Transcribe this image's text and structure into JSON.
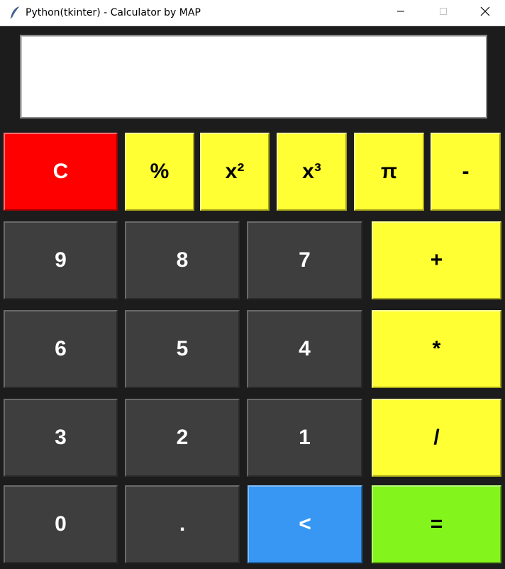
{
  "window": {
    "title": "Python(tkinter) - Calculator by MAP"
  },
  "display": {
    "value": ""
  },
  "buttons": {
    "clear": "C",
    "percent": "%",
    "square": "x²",
    "cube": "x³",
    "pi": "π",
    "minus": "-",
    "nine": "9",
    "eight": "8",
    "seven": "7",
    "plus": "+",
    "six": "6",
    "five": "5",
    "four": "4",
    "multiply": "*",
    "three": "3",
    "two": "2",
    "one": "1",
    "divide": "/",
    "zero": "0",
    "dot": ".",
    "backspace": "<",
    "equals": "="
  },
  "colors": {
    "background": "#1c1c1c",
    "dark_key": "#3e3e3e",
    "operator_key": "#ffff33",
    "clear_key": "#ff0000",
    "backspace_key": "#3797f2",
    "equals_key": "#84f51c"
  },
  "icons": {
    "app": "feather-icon",
    "minimize": "minimize-icon",
    "maximize": "maximize-icon",
    "close": "close-icon"
  }
}
